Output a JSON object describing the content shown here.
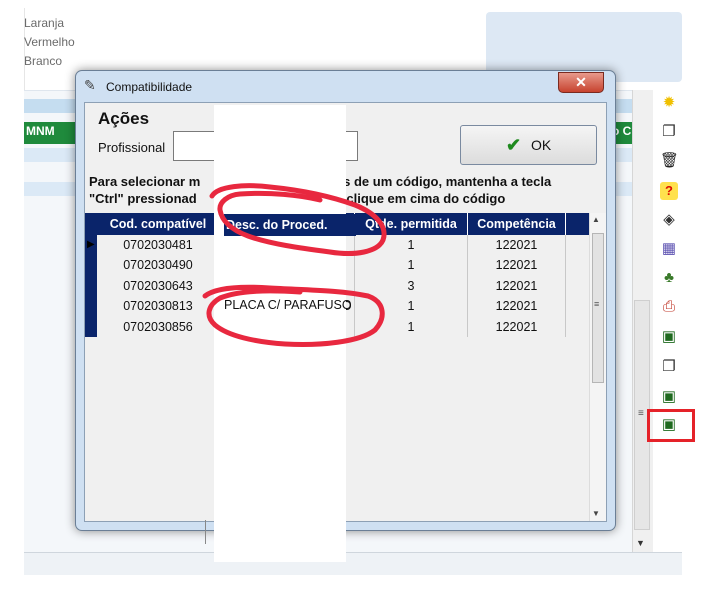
{
  "background": {
    "labels": [
      "Laranja",
      "Vermelho",
      "Branco"
    ],
    "grid_header_left": "MNM",
    "grid_header_right": "o C",
    "header_color": "#1f8a3c",
    "toolbar_icons": [
      "sun-icon",
      "copy-icon",
      "trash-icon",
      "help-icon",
      "eraser-icon",
      "calendar-icon",
      "people-icon",
      "printer-icon",
      "monitor-icon",
      "documents-icon",
      "monitor-icon",
      "monitor-icon"
    ]
  },
  "dialog": {
    "title": "Compatibilidade",
    "close_label": "✕",
    "section_title": "Ações",
    "profissional_label": "Profissional",
    "profissional_value": "",
    "ok_label": "OK",
    "instruction_line1": "Para selecionar mais de um item, mais de um código, mantenha a tecla",
    "instruction_line2": "\"Ctrl\" pressionada e clique em cima do código",
    "instruction_line1_visible": [
      "Para selecionar m",
      "ais de um código, mantenha a tecla"
    ],
    "instruction_line2_visible": [
      "\"Ctrl\" pressionad",
      "a e clique em cima do código"
    ]
  },
  "table": {
    "headers": [
      "Cod. compatível",
      "Desc. do Proced.",
      "Qtde. permitida",
      "Competência"
    ],
    "rows": [
      {
        "code": "0702030481",
        "desc": "",
        "qtde": "1",
        "competencia": "122021"
      },
      {
        "code": "0702030490",
        "desc": "",
        "qtde": "1",
        "competencia": "122021"
      },
      {
        "code": "0702030643",
        "desc": "",
        "qtde": "3",
        "competencia": "122021"
      },
      {
        "code": "0702030813",
        "desc": "PLACA C/ PARAFUSO",
        "qtde": "1",
        "competencia": "122021"
      },
      {
        "code": "0702030856",
        "desc": "",
        "qtde": "1",
        "competencia": "122021"
      }
    ],
    "header_color": "#0a246a"
  },
  "annotation_color": "#e8283f"
}
